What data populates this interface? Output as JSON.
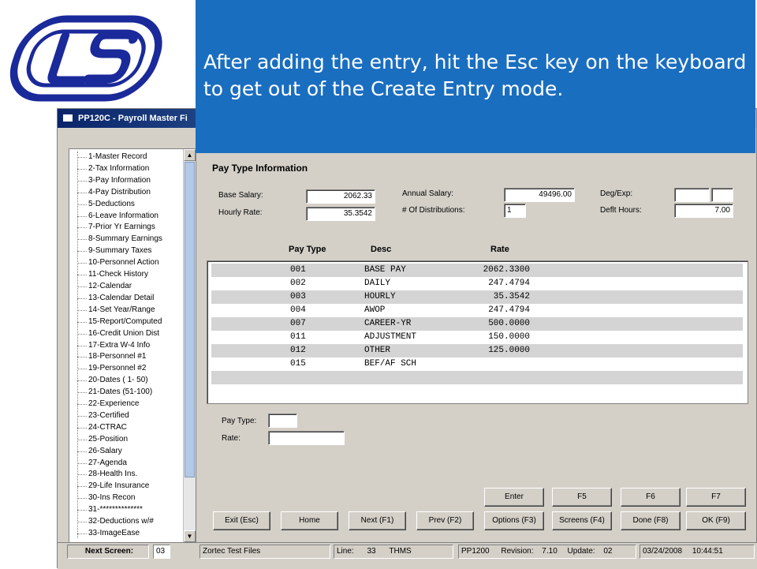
{
  "callout": {
    "text": "After adding the entry, hit the Esc key on the keyboard to get out of the Create Entry mode."
  },
  "window": {
    "title": "PP120C - Payroll Master Fi"
  },
  "tree": {
    "items": [
      "1-Master Record",
      "2-Tax Information",
      "3-Pay Information",
      "4-Pay Distribution",
      "5-Deductions",
      "6-Leave Information",
      "7-Prior Yr Earnings",
      "8-Summary Earnings",
      "9-Summary Taxes",
      "10-Personnel Action",
      "11-Check History",
      "12-Calendar",
      "13-Calendar Detail",
      "14-Set Year/Range",
      "15-Report/Computed",
      "16-Credit Union Dist",
      "17-Extra W-4 Info",
      "18-Personnel #1",
      "19-Personnel #2",
      "20-Dates ( 1- 50)",
      "21-Dates (51-100)",
      "22-Experience",
      "23-Certified",
      "24-CTRAC",
      "25-Position",
      "26-Salary",
      "27-Agenda",
      "28-Health Ins.",
      "29-Life Insurance",
      "30-Ins Recon",
      "31-**************",
      "32-Deductions w/#",
      "33-ImageEase"
    ]
  },
  "pay_info": {
    "section_title": "Pay Type Information",
    "base_salary_label": "Base Salary:",
    "base_salary": "2062.33",
    "hourly_rate_label": "Hourly Rate:",
    "hourly_rate": "35.3542",
    "annual_salary_label": "Annual Salary:",
    "annual_salary": "49496.00",
    "num_dist_label": "# Of Distributions:",
    "num_dist": "1",
    "deg_exp_label": "Deg/Exp:",
    "deg_exp_1": "",
    "deg_exp_2": "",
    "deflt_hours_label": "Deflt Hours:",
    "deflt_hours": "7.00"
  },
  "grid": {
    "headers": [
      "Pay Type",
      "Desc",
      "Rate"
    ],
    "rows": [
      {
        "pay_type": "001",
        "desc": "BASE PAY",
        "rate": "2062.3300"
      },
      {
        "pay_type": "002",
        "desc": "DAILY",
        "rate": "247.4794"
      },
      {
        "pay_type": "003",
        "desc": "HOURLY",
        "rate": "35.3542"
      },
      {
        "pay_type": "004",
        "desc": "AWOP",
        "rate": "247.4794"
      },
      {
        "pay_type": "007",
        "desc": "CAREER-YR",
        "rate": "500.0000"
      },
      {
        "pay_type": "011",
        "desc": "ADJUSTMENT",
        "rate": "150.0000"
      },
      {
        "pay_type": "012",
        "desc": "OTHER",
        "rate": "125.0000"
      },
      {
        "pay_type": "015",
        "desc": "BEF/AF SCH",
        "rate": ""
      }
    ]
  },
  "entry": {
    "pay_type_label": "Pay Type:",
    "pay_type_value": "",
    "rate_label": "Rate:",
    "rate_value": ""
  },
  "buttons": {
    "enter": "Enter",
    "f5": "F5",
    "f6": "F6",
    "f7": "F7",
    "exit": "Exit (Esc)",
    "home": "Home",
    "next": "Next (F1)",
    "prev": "Prev (F2)",
    "options": "Options (F3)",
    "screens": "Screens (F4)",
    "done": "Done (F8)",
    "ok": "OK (F9)"
  },
  "status": {
    "next_screen_label": "Next Screen:",
    "next_screen_value": "03",
    "db_name": "Zortec Test Files",
    "line_label": "Line:",
    "line_value": "33",
    "user": "THMS",
    "program": "PP1200",
    "revision_label": "Revision:",
    "revision_value": "7.10",
    "update_label": "Update:",
    "update_value": "02",
    "date": "03/24/2008",
    "time": "10:44:51"
  },
  "colors": {
    "callout_bg": "#1a6ec0",
    "logo_blue": "#1a2a9a",
    "row_shade": "#d4d4d4"
  }
}
